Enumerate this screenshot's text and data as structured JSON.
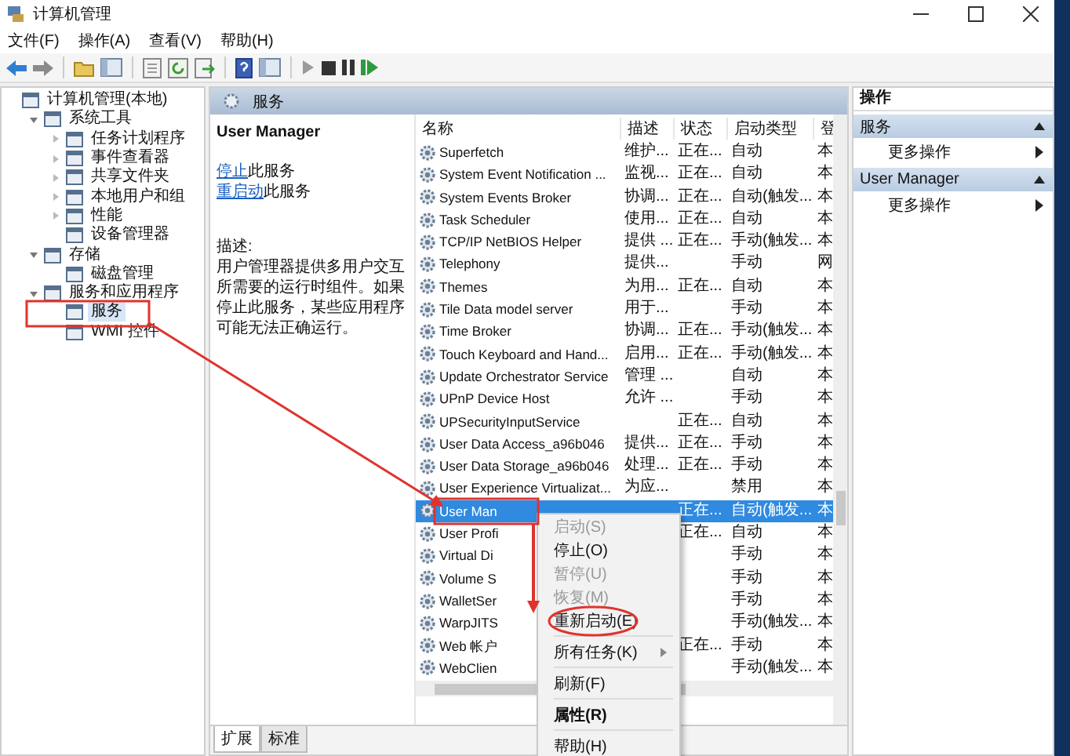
{
  "window": {
    "title": "计算机管理"
  },
  "menu": [
    "文件(F)",
    "操作(A)",
    "查看(V)",
    "帮助(H)"
  ],
  "tree": [
    {
      "label": "计算机管理(本地)",
      "selected": false,
      "children": [
        {
          "label": "系统工具",
          "expanded": true,
          "selected": false,
          "children": [
            {
              "label": "任务计划程序",
              "expanded": false,
              "selected": false
            },
            {
              "label": "事件查看器",
              "expanded": false,
              "selected": false
            },
            {
              "label": "共享文件夹",
              "expanded": false,
              "selected": false
            },
            {
              "label": "本地用户和组",
              "expanded": false,
              "selected": false
            },
            {
              "label": "性能",
              "expanded": false,
              "selected": false
            },
            {
              "label": "设备管理器",
              "selected": false
            }
          ]
        },
        {
          "label": "存储",
          "expanded": true,
          "selected": false,
          "children": [
            {
              "label": "磁盘管理",
              "selected": false
            }
          ]
        },
        {
          "label": "服务和应用程序",
          "expanded": true,
          "selected": false,
          "children": [
            {
              "label": "服务",
              "selected": true
            },
            {
              "label": "WMI 控件",
              "selected": false
            }
          ]
        }
      ]
    }
  ],
  "services_pane": {
    "title": "服务",
    "detail": {
      "service_name": "User Manager",
      "actions": [
        {
          "link": "停止",
          "rest": "此服务"
        },
        {
          "link": "重启动",
          "rest": "此服务"
        }
      ],
      "description_label": "描述:",
      "description": "用户管理器提供多用户交互所需要的运行时组件。如果停止此服务，某些应用程序可能无法正确运行。"
    },
    "table": {
      "columns": [
        "名称",
        "描述",
        "状态",
        "启动类型",
        "登"
      ],
      "rows": [
        {
          "name": "Superfetch",
          "description": "维护...",
          "status": "正在...",
          "startup": "自动",
          "column_5": "本",
          "selected": false
        },
        {
          "name": "System Event Notification ...",
          "description": "监视...",
          "status": "正在...",
          "startup": "自动",
          "column_5": "本",
          "selected": false
        },
        {
          "name": "System Events Broker",
          "description": "协调...",
          "status": "正在...",
          "startup": "自动(触发...",
          "column_5": "本",
          "selected": false
        },
        {
          "name": "Task Scheduler",
          "description": "使用...",
          "status": "正在...",
          "startup": "自动",
          "column_5": "本",
          "selected": false
        },
        {
          "name": "TCP/IP NetBIOS Helper",
          "description": "提供 ...",
          "status": "正在...",
          "startup": "手动(触发...",
          "column_5": "本",
          "selected": false
        },
        {
          "name": "Telephony",
          "description": "提供...",
          "startup": "手动",
          "column_5": "网",
          "selected": false
        },
        {
          "name": "Themes",
          "description": "为用...",
          "status": "正在...",
          "startup": "自动",
          "column_5": "本",
          "selected": false
        },
        {
          "name": "Tile Data model server",
          "description": "用于...",
          "startup": "手动",
          "column_5": "本",
          "selected": false
        },
        {
          "name": "Time Broker",
          "description": "协调...",
          "status": "正在...",
          "startup": "手动(触发...",
          "column_5": "本",
          "selected": false
        },
        {
          "name": "Touch Keyboard and Hand...",
          "description": "启用...",
          "status": "正在...",
          "startup": "手动(触发...",
          "column_5": "本",
          "selected": false
        },
        {
          "name": "Update Orchestrator Service",
          "description": "管理 ...",
          "startup": "自动",
          "column_5": "本",
          "selected": false
        },
        {
          "name": "UPnP Device Host",
          "description": "允许 ...",
          "startup": "手动",
          "column_5": "本",
          "selected": false
        },
        {
          "name": "UPSecurityInputService",
          "status": "正在...",
          "startup": "自动",
          "column_5": "本",
          "selected": false
        },
        {
          "name": "User Data Access_a96b046",
          "description": "提供...",
          "status": "正在...",
          "startup": "手动",
          "column_5": "本",
          "selected": false
        },
        {
          "name": "User Data Storage_a96b046",
          "description": "处理...",
          "status": "正在...",
          "startup": "手动",
          "column_5": "本",
          "selected": false
        },
        {
          "name": "User Experience Virtualizat...",
          "description": "为应...",
          "startup": "禁用",
          "column_5": "本",
          "selected": false
        },
        {
          "name": "User Man",
          "status": "正在...",
          "startup": "自动(触发...",
          "column_5": "本",
          "selected": true
        },
        {
          "name": "User Profi",
          "status": "正在...",
          "startup": "自动",
          "column_5": "本",
          "selected": false
        },
        {
          "name": "Virtual Di",
          "startup": "手动",
          "column_5": "本",
          "selected": false
        },
        {
          "name": "Volume S",
          "startup": "手动",
          "column_5": "本",
          "selected": false
        },
        {
          "name": "WalletSer",
          "startup": "手动",
          "column_5": "本",
          "selected": false
        },
        {
          "name": "WarpJITS",
          "startup": "手动(触发...",
          "column_5": "本",
          "selected": false
        },
        {
          "name": "Web 帐户",
          "status": "正在...",
          "startup": "手动",
          "column_5": "本",
          "selected": false
        },
        {
          "name": "WebClien",
          "startup": "手动(触发...",
          "column_5": "本",
          "selected": false
        }
      ]
    },
    "tabs": [
      {
        "label": "扩展",
        "selected": true
      },
      {
        "label": "标准",
        "selected": false
      }
    ]
  },
  "actions_pane": {
    "title": "操作",
    "sections": [
      {
        "title": "服务",
        "items": [
          "更多操作"
        ]
      },
      {
        "title": "User Manager",
        "items": [
          "更多操作"
        ]
      }
    ]
  },
  "context_menu": [
    {
      "kind": "item",
      "label": "启动(S)",
      "disabled": true,
      "default": false,
      "submenu": false
    },
    {
      "kind": "item",
      "label": "停止(O)",
      "disabled": false,
      "default": false,
      "submenu": false
    },
    {
      "kind": "item",
      "label": "暂停(U)",
      "disabled": true,
      "default": false,
      "submenu": false
    },
    {
      "kind": "item",
      "label": "恢复(M)",
      "disabled": true,
      "default": false,
      "submenu": false
    },
    {
      "kind": "item",
      "label": "重新启动(E)",
      "disabled": false,
      "default": false,
      "submenu": false
    },
    {
      "kind": "separator"
    },
    {
      "kind": "item",
      "label": "所有任务(K)",
      "disabled": false,
      "default": false,
      "submenu": true
    },
    {
      "kind": "separator"
    },
    {
      "kind": "item",
      "label": "刷新(F)",
      "disabled": false,
      "default": false,
      "submenu": false
    },
    {
      "kind": "separator"
    },
    {
      "kind": "item",
      "label": "属性(R)",
      "disabled": false,
      "default": true,
      "submenu": false
    },
    {
      "kind": "separator"
    },
    {
      "kind": "item",
      "label": "帮助(H)",
      "disabled": false,
      "default": false,
      "submenu": false
    }
  ]
}
